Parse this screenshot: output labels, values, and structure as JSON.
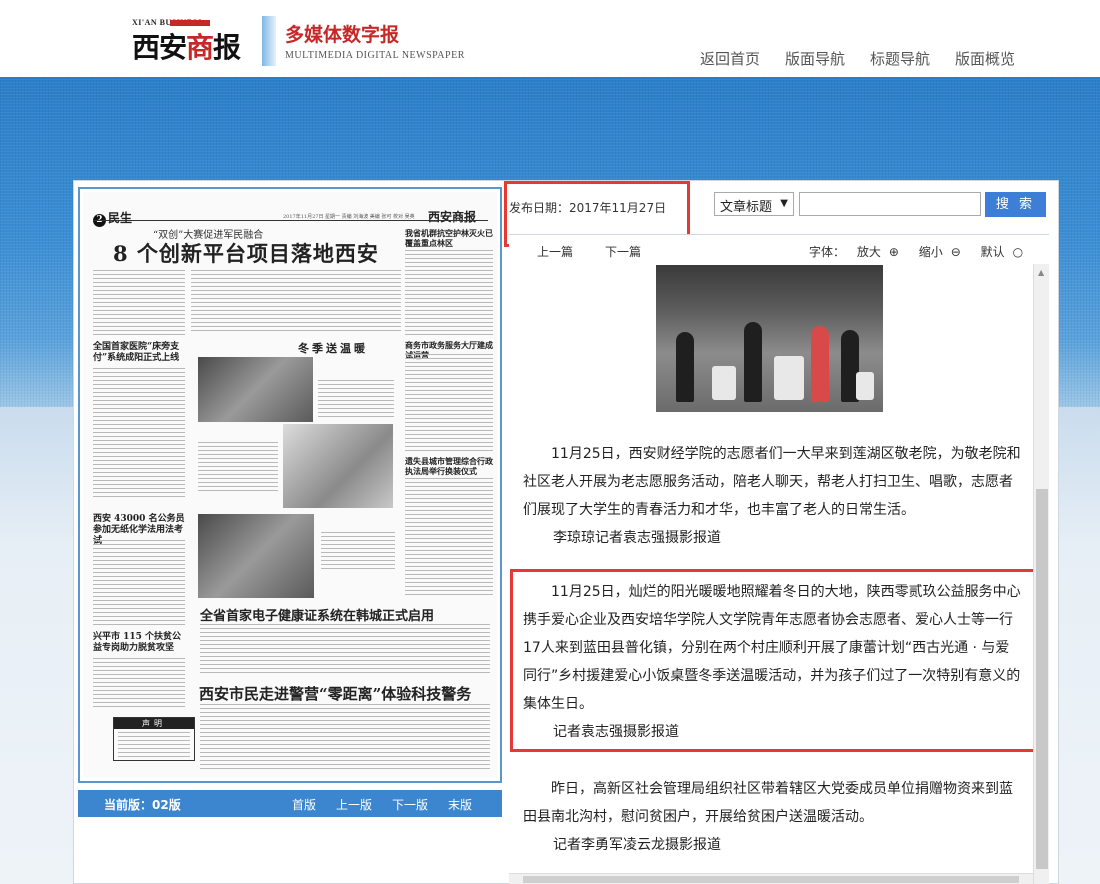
{
  "header": {
    "logo_en": "XI'AN BUSINESS",
    "logo_cn_a": "西安",
    "logo_cn_b": "商",
    "logo_cn_c": "报",
    "subtitle_cn": "多媒体数字报",
    "subtitle_en": "MULTIMEDIA DIGITAL NEWSPAPER",
    "nav": [
      "返回首页",
      "版面导航",
      "标题导航",
      "版面概览"
    ]
  },
  "paper": {
    "section_num": "2",
    "section_name": "民生",
    "meta": "2017年11月27日 星期一   责编 刘海波   美编 张可   校对 吴英",
    "brand": "西安商报",
    "kicker": "“双创”大赛促进军民融合",
    "headline": "8 个创新平台项目落地西安",
    "sub1": "全国首家医院“床旁支付”系统成阳正式上线",
    "sub2": "西安 43000 名公务员参加无纸化学法用法考试",
    "sub3": "兴平市 115 个扶贫公益专岗助力脱贫攻坚",
    "winter": "冬季送温暖",
    "right_sub1": "我省机群抗空护林灭火已覆盖重点林区",
    "right_sub2": "商务市政务服务大厅建成试运营",
    "right_sub3": "遗失县城市管理综合行政执法局举行换装仪式",
    "h2": "全省首家电子健康证系统在韩城正式启用",
    "h3": "西安市民走进警营“零距离”体验科技警务",
    "notice": "声明"
  },
  "pagebar": {
    "current": "当前版：02版",
    "links": [
      "首版",
      "上一版",
      "下一版",
      "末版"
    ]
  },
  "toolbar": {
    "date": "发布日期：2017年11月27日",
    "select_value": "文章标题",
    "search_placeholder": "",
    "search_label": "搜 索"
  },
  "article": {
    "prev": "上一篇",
    "next": "下一篇",
    "font_label": "字体：",
    "font_large": "放大",
    "font_small": "缩小",
    "font_default": "默认",
    "paragraphs": [
      "11月25日，西安财经学院的志愿者们一大早来到莲湖区敬老院，为敬老院和社区老人开展为老志愿服务活动，陪老人聊天，帮老人打扫卫生、唱歌，志愿者们展现了大学生的青春活力和才华，也丰富了老人的日常生活。",
      "李琼琼记者袁志强摄影报道",
      "11月25日，灿烂的阳光暖暖地照耀着冬日的大地，陕西零贰玖公益服务中心携手爱心企业及西安培华学院人文学院青年志愿者协会志愿者、爱心人士等一行17人来到蓝田县普化镇，分别在两个村庄顺利开展了康蕾计划“西古光通 · 与爱同行”乡村援建爱心小饭桌暨冬季送温暖活动，并为孩子们过了一次特别有意义的集体生日。",
      "记者袁志强摄影报道",
      "昨日，高新区社会管理局组织社区带着辖区大党委成员单位捐赠物资来到蓝田县南北沟村，慰问贫困户，开展给贫困户送温暖活动。",
      "记者李勇军凌云龙摄影报道"
    ]
  }
}
